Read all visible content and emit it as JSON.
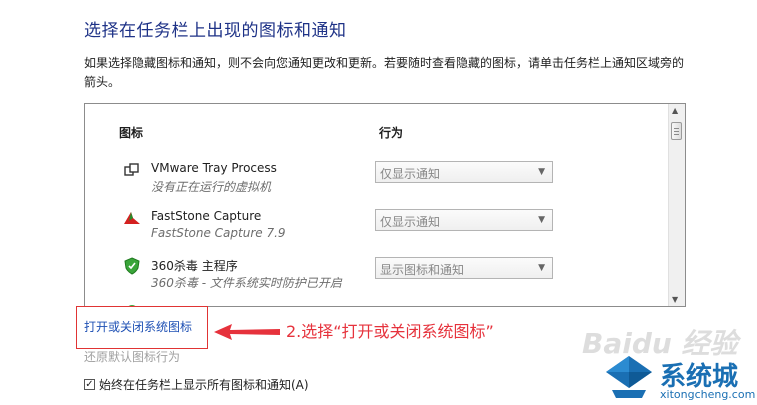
{
  "header": {
    "title": "选择在任务栏上出现的图标和通知",
    "description": "如果选择隐藏图标和通知，则不会向您通知更改和更新。若要随时查看隐藏的图标，请单击任务栏上通知区域旁的箭头。"
  },
  "table": {
    "col_icon": "图标",
    "col_behavior": "行为",
    "rows": [
      {
        "name": "VMware Tray Process",
        "sub": "没有正在运行的虚拟机",
        "behavior": "仅显示通知",
        "icon": "vmware-icon"
      },
      {
        "name": "FastStone Capture",
        "sub": "FastStone Capture 7.9",
        "behavior": "仅显示通知",
        "icon": "faststone-icon"
      },
      {
        "name": "360杀毒 主程序",
        "sub": "360杀毒 - 文件系统实时防护已开启",
        "behavior": "显示图标和通知",
        "icon": "shield-icon"
      }
    ]
  },
  "links": {
    "system_icons": "打开或关闭系统图标",
    "restore": "还原默认图标行为"
  },
  "annotation": "2.选择“打开或关闭系统图标”",
  "checkbox": {
    "label": "始终在任务栏上显示所有图标和通知(A)",
    "checked": true,
    "mark": "✓"
  },
  "watermark": {
    "baidu": "Baidu 经验",
    "brand": "系统城",
    "brand_url": "xitongcheng.com"
  },
  "colors": {
    "title": "#1e3287",
    "link": "#1e50b4",
    "annotation": "#e6323c",
    "brand": "#1a6fb3"
  }
}
